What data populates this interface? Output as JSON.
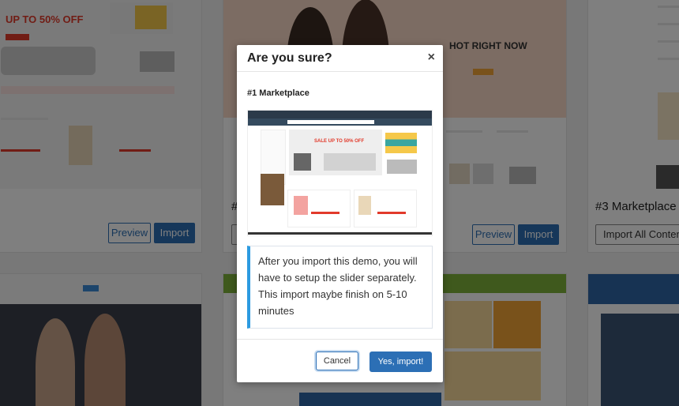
{
  "background": {
    "card1": {
      "sale_text": "UP TO 50% OFF"
    },
    "card2": {
      "headline": "HOT RIGHT NOW",
      "label_prefix": "#",
      "preview_label": "Preview",
      "import_label": "Import"
    },
    "card_left": {
      "preview_label": "Preview",
      "import_label": "Import"
    },
    "card3": {
      "title": "#3 Marketplace",
      "import_all_label": "Import All Content"
    }
  },
  "modal": {
    "title": "Are you sure?",
    "close_glyph": "×",
    "demo_name": "#1 Marketplace",
    "preview": {
      "sale_text": "SALE UP TO 50% OFF"
    },
    "note": "After you import this demo, you will have to setup the slider separately. This import maybe finish on 5-10 minutes",
    "cancel_label": "Cancel",
    "confirm_label": "Yes, import!"
  },
  "colors": {
    "accent": "#2c6fb5",
    "note_border": "#2c9be0",
    "sale_red": "#e23a2b"
  }
}
